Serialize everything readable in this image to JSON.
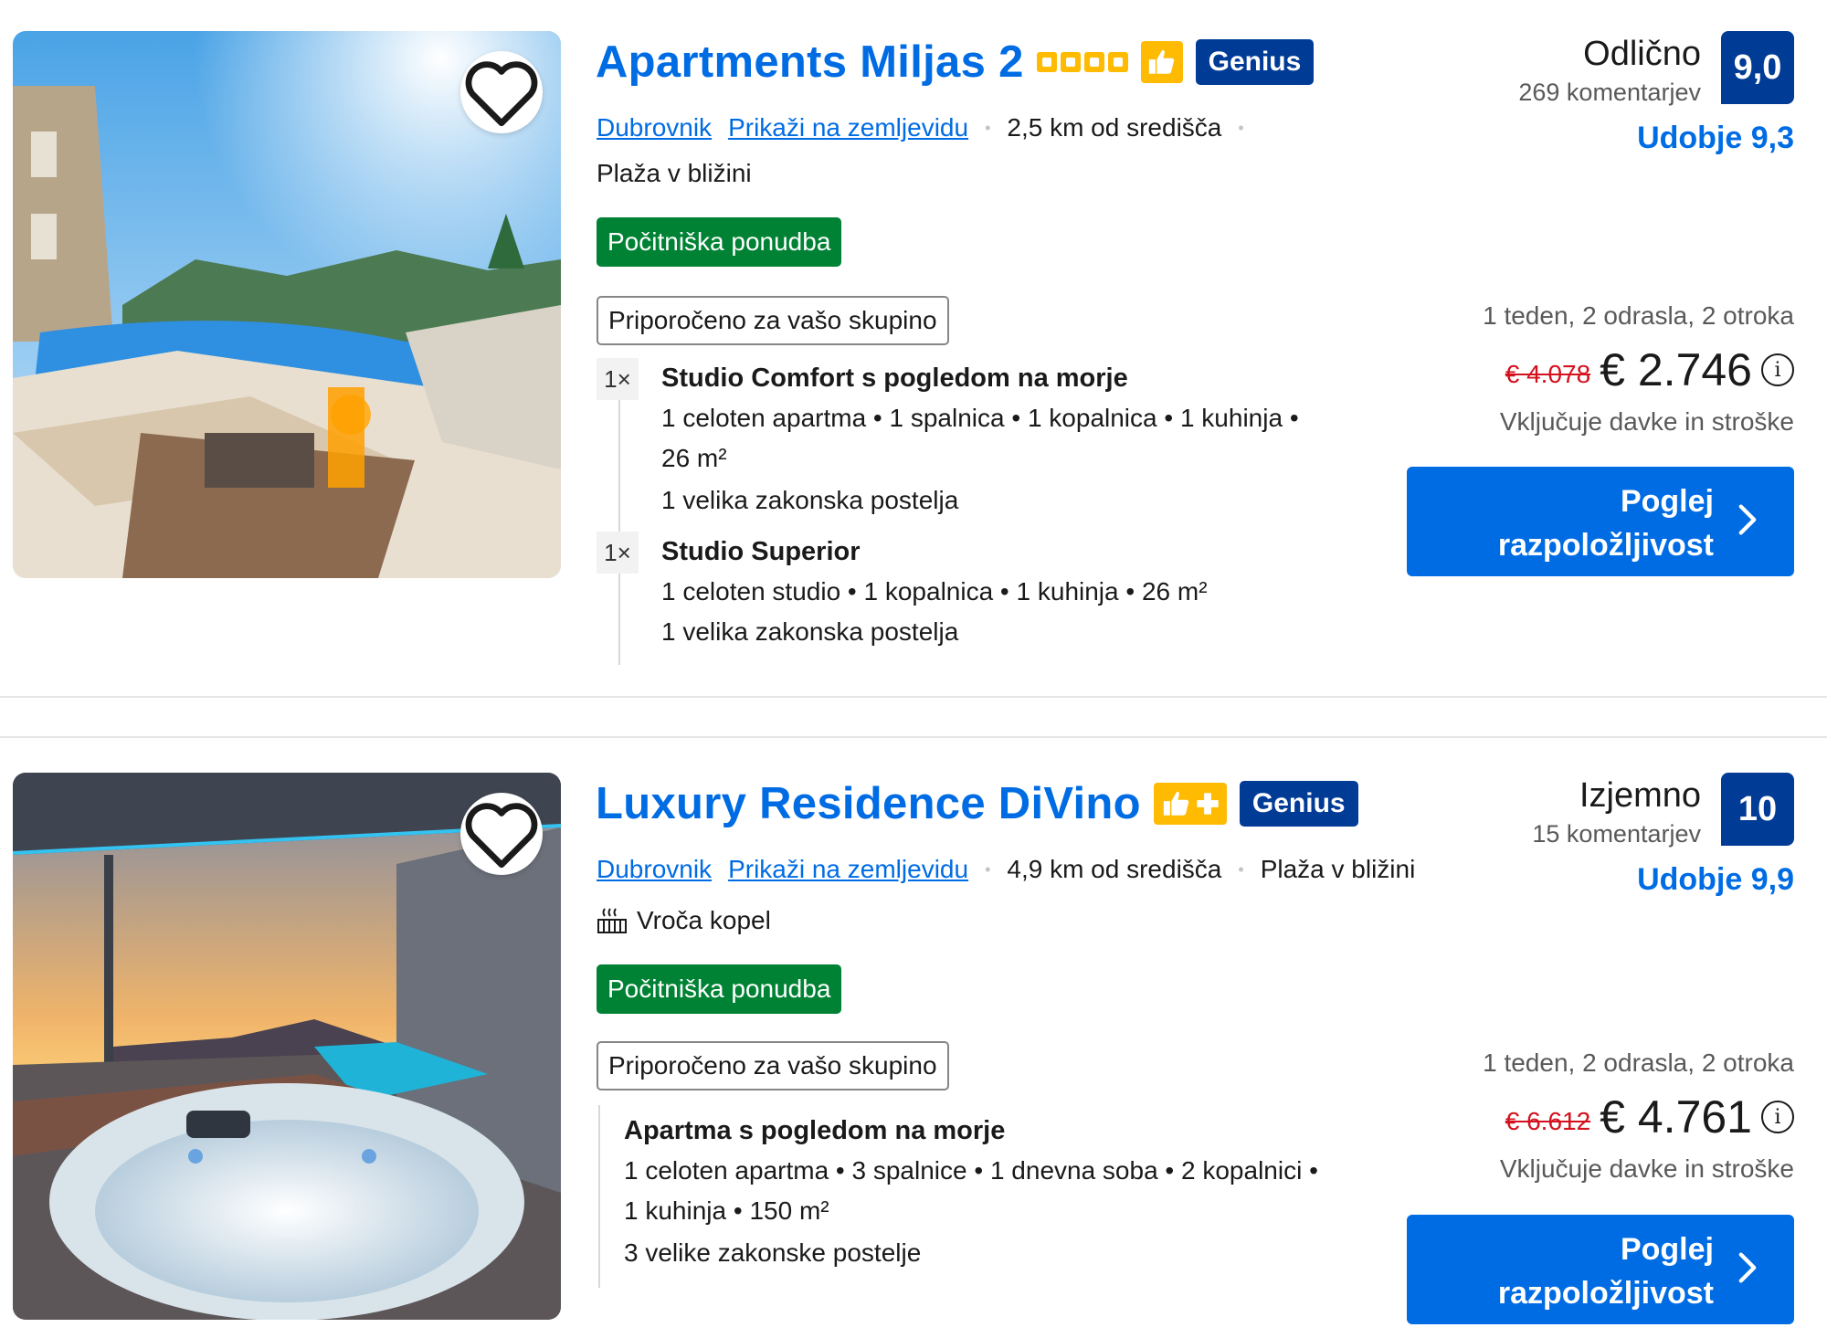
{
  "listings": [
    {
      "title": "Apartments Miljas 2",
      "city": "Dubrovnik",
      "map_link": "Prikaži na zemljevidu",
      "distance": "2,5 km od središča",
      "beach": "Plaža v bližini",
      "deal": "Počitniška ponudba",
      "recommended": "Priporočeno za vašo skupino",
      "genius": "Genius",
      "score_word": "Odlično",
      "reviews": "269 komentarjev",
      "score": "9,0",
      "comfort": "Udobje 9,3",
      "stay": "1 teden, 2 odrasla, 2 otroka",
      "old_price": "€ 4.078",
      "price": "€ 2.746",
      "taxes": "Vključuje davke in stroške",
      "cta_line1": "Poglej",
      "cta_line2": "razpoložljivost",
      "rooms": [
        {
          "qty": "1×",
          "name": "Studio Comfort s pogledom na morje",
          "details_line1": "1 celoten apartma • 1 spalnica • 1 kopalnica • 1 kuhinja •",
          "details_line2": "26 m²",
          "beds": "1 velika zakonska postelja"
        },
        {
          "qty": "1×",
          "name": "Studio Superior",
          "details_line1": "1 celoten studio • 1 kopalnica • 1 kuhinja • 26 m²",
          "beds": "1 velika zakonska postelja"
        }
      ]
    },
    {
      "title": "Luxury Residence DiVino",
      "city": "Dubrovnik",
      "map_link": "Prikaži na zemljevidu",
      "distance": "4,9 km od središča",
      "beach": "Plaža v bližini",
      "amenity": "Vroča kopel",
      "deal": "Počitniška ponudba",
      "recommended": "Priporočeno za vašo skupino",
      "genius": "Genius",
      "score_word": "Izjemno",
      "reviews": "15 komentarjev",
      "score": "10",
      "comfort": "Udobje 9,9",
      "stay": "1 teden, 2 odrasla, 2 otroka",
      "old_price": "€ 6.612",
      "price": "€ 4.761",
      "taxes": "Vključuje davke in stroške",
      "cta_line1": "Poglej",
      "cta_line2": "razpoložljivost",
      "rooms": [
        {
          "name": "Apartma s pogledom na morje",
          "details_line1": "1 celoten apartma • 3 spalnice • 1 dnevna soba • 2 kopalnici •",
          "details_line2": "1 kuhinja • 150 m²",
          "beds": "3 velike zakonske postelje"
        }
      ]
    }
  ],
  "colors": {
    "link_blue": "#006ce4",
    "genius_blue": "#003b95",
    "deal_green": "#008234",
    "star_yellow": "#febb02",
    "old_price_red": "#d4111e"
  },
  "icons": {
    "favorite": "heart-icon",
    "chevron": "chevron-right-icon",
    "info": "info-icon",
    "hot_tub": "hot-tub-icon",
    "thumb": "thumbs-up-icon"
  }
}
